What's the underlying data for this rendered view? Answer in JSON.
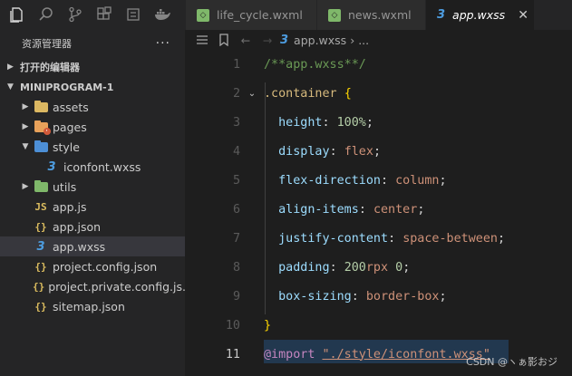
{
  "activity_bar": {
    "icons": [
      "files-icon",
      "search-icon",
      "source-control-icon",
      "extensions-icon",
      "widget-icon",
      "docker-icon"
    ]
  },
  "sidebar": {
    "title": "资源管理器",
    "more": "···",
    "open_editors": "打开的编辑器",
    "project": "MINIPROGRAM-1",
    "tree": [
      {
        "label": "assets",
        "type": "folder",
        "color": "#dcb862"
      },
      {
        "label": "pages",
        "type": "folder",
        "color": "#e8a15a"
      },
      {
        "label": "style",
        "type": "folder-open",
        "color": "#4d8fd6"
      },
      {
        "label": "iconfont.wxss",
        "type": "css"
      },
      {
        "label": "utils",
        "type": "folder",
        "color": "#7fb86a"
      },
      {
        "label": "app.js",
        "type": "js"
      },
      {
        "label": "app.json",
        "type": "json"
      },
      {
        "label": "app.wxss",
        "type": "css"
      },
      {
        "label": "project.config.json",
        "type": "json"
      },
      {
        "label": "project.private.config.js...",
        "type": "json"
      },
      {
        "label": "sitemap.json",
        "type": "json"
      }
    ]
  },
  "tabs": [
    {
      "label": "life_cycle.wxml",
      "active": false
    },
    {
      "label": "news.wxml",
      "active": false
    },
    {
      "label": "app.wxss",
      "active": true
    }
  ],
  "tab_close": "✕",
  "breadcrumb": {
    "file": "app.wxss",
    "sep": "›",
    "more": "..."
  },
  "editor": {
    "line_numbers": [
      "1",
      "2",
      "3",
      "4",
      "5",
      "6",
      "7",
      "8",
      "9",
      "10",
      "11"
    ],
    "comment": "/**app.wxss**/",
    "selector": ".container",
    "open_brace": "{",
    "close_brace": "}",
    "props": [
      {
        "name": "height",
        "value": "100%",
        "value_type": "num"
      },
      {
        "name": "display",
        "value": "flex",
        "value_type": "val"
      },
      {
        "name": "flex-direction",
        "value": "column",
        "value_type": "val"
      },
      {
        "name": "align-items",
        "value": "center",
        "value_type": "val"
      },
      {
        "name": "justify-content",
        "value": "space-between",
        "value_type": "val"
      },
      {
        "name": "padding",
        "value_num": "200",
        "value_unit": "rpx",
        "value_num2": "0",
        "value_type": "mixed"
      },
      {
        "name": "box-sizing",
        "value": "border-box",
        "value_type": "val"
      }
    ],
    "import_kw": "@import",
    "import_str": "\"./style/iconfont.wxss\""
  },
  "watermark": "CSDN @ヽぁ影おジ"
}
